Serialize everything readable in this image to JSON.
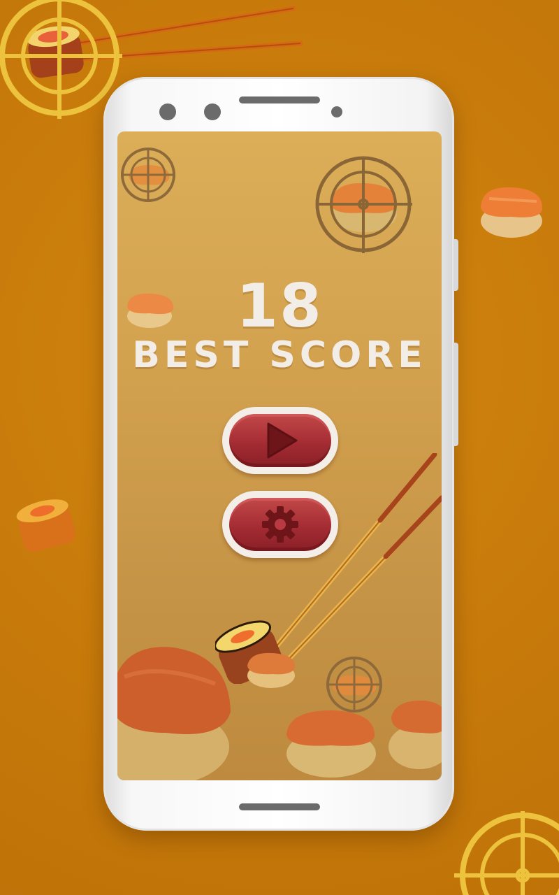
{
  "game": {
    "score": "18",
    "best_label": "BEST SCORE"
  },
  "buttons": {
    "play_icon": "play-icon",
    "settings_icon": "gear-icon"
  },
  "colors": {
    "background": "#c97a0b",
    "screen": "#d3a24f",
    "button_red": "#a42c33",
    "button_rim": "#f4eee9",
    "text": "#f2ede6",
    "crosshair": "#e8b73a"
  }
}
